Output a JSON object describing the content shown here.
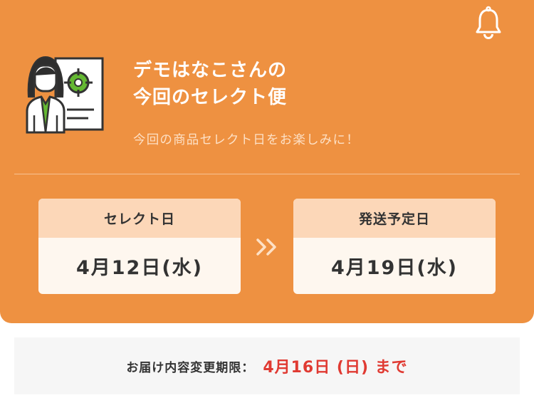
{
  "header": {
    "title_line1": "デモはなこさんの",
    "title_line2": "今回のセレクト便",
    "subtitle": "今回の商品セレクト日をお楽しみに！",
    "bell_icon": "bell-icon",
    "avatar_icon": "person-with-document-icon"
  },
  "dates": {
    "select_label": "セレクト日",
    "select_value": "4月12日(水)",
    "ship_label": "発送予定日",
    "ship_value": "4月19日(水)",
    "arrow_icon": "double-chevron-right-icon"
  },
  "deadline": {
    "label": "お届け内容変更期限：",
    "value": "4月16日 (日) まで"
  },
  "colors": {
    "primary": "#ee9141",
    "card_head": "#fcd7b8",
    "card_body": "#fef7ef",
    "deadline_red": "#e03a32"
  }
}
